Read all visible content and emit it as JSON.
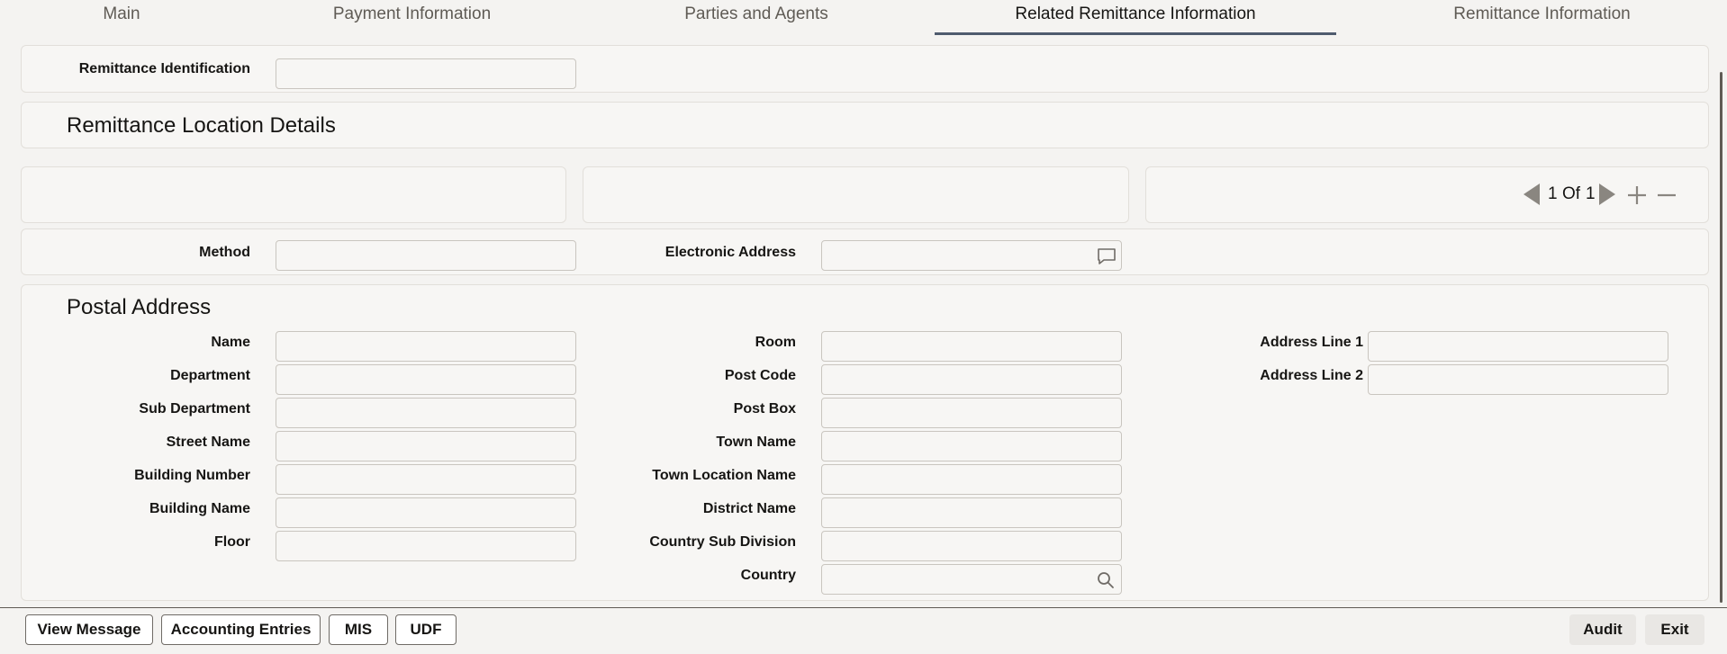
{
  "tabs": [
    {
      "label": "Main"
    },
    {
      "label": "Payment Information"
    },
    {
      "label": "Parties and Agents"
    },
    {
      "label": "Related Remittance Information"
    },
    {
      "label": "Remittance Information"
    }
  ],
  "remittance_identification": {
    "label": "Remittance Identification",
    "value": ""
  },
  "location_details": {
    "title": "Remittance Location Details",
    "pagination": {
      "current": "1",
      "of_label": "Of",
      "total": "1"
    },
    "method": {
      "label": "Method",
      "value": ""
    },
    "electronic_address": {
      "label": "Electronic Address",
      "value": ""
    }
  },
  "postal_address": {
    "title": "Postal Address",
    "col1": [
      {
        "label": "Name",
        "value": ""
      },
      {
        "label": "Department",
        "value": ""
      },
      {
        "label": "Sub Department",
        "value": ""
      },
      {
        "label": "Street Name",
        "value": ""
      },
      {
        "label": "Building Number",
        "value": ""
      },
      {
        "label": "Building Name",
        "value": ""
      },
      {
        "label": "Floor",
        "value": ""
      }
    ],
    "col2": [
      {
        "label": "Room",
        "value": ""
      },
      {
        "label": "Post Code",
        "value": ""
      },
      {
        "label": "Post Box",
        "value": ""
      },
      {
        "label": "Town Name",
        "value": ""
      },
      {
        "label": "Town Location Name",
        "value": ""
      },
      {
        "label": "District Name",
        "value": ""
      },
      {
        "label": "Country Sub Division",
        "value": ""
      },
      {
        "label": "Country",
        "value": ""
      }
    ],
    "col3": [
      {
        "label": "Address Line 1",
        "value": ""
      },
      {
        "label": "Address Line 2",
        "value": ""
      }
    ]
  },
  "footer": {
    "view_message": "View Message",
    "accounting_entries": "Accounting Entries",
    "mis": "MIS",
    "udf": "UDF",
    "audit": "Audit",
    "exit": "Exit"
  },
  "icons": {
    "prev": "triangle-left-icon",
    "next": "triangle-right-icon",
    "add": "plus-icon",
    "remove": "minus-icon",
    "chat": "chat-bubble-icon",
    "search": "search-icon"
  },
  "colors": {
    "active_tab_underline": "#4f5b6e",
    "background": "#f4f3f1"
  }
}
